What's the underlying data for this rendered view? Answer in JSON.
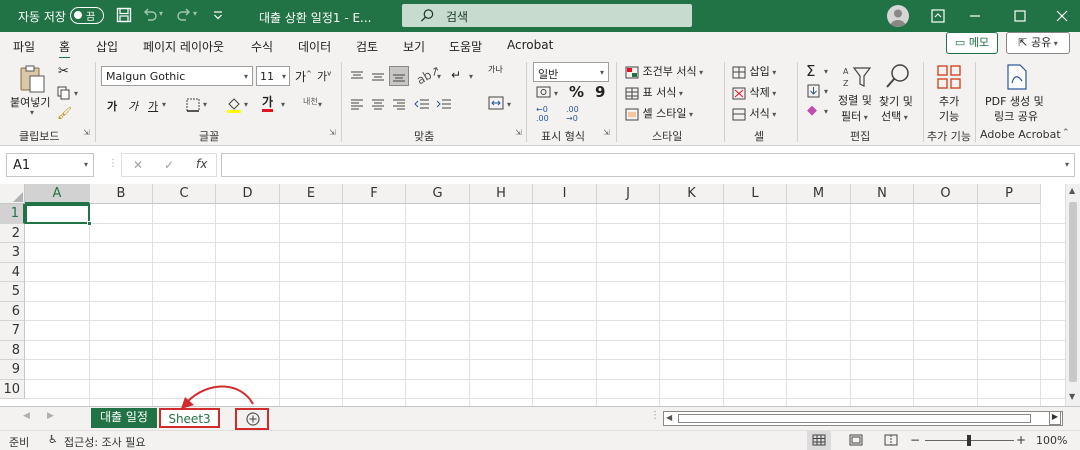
{
  "titlebar": {
    "autosave_label": "자동 저장",
    "autosave_state": "끔",
    "doc_title": "대출 상환 일정1 - E...",
    "search_label": "검색"
  },
  "menu": {
    "tabs": [
      "파일",
      "홈",
      "삽입",
      "페이지 레이아웃",
      "수식",
      "데이터",
      "검토",
      "보기",
      "도움말",
      "Acrobat"
    ],
    "active_tab": "홈",
    "memo_label": "메모",
    "share_label": "공유"
  },
  "ribbon": {
    "clipboard": {
      "paste_label": "붙여넣기",
      "group_label": "클립보드"
    },
    "font": {
      "font_name": "Malgun Gothic",
      "font_size": "11",
      "bold": "가",
      "italic": "가",
      "underline": "가",
      "font_color_sample": "가",
      "phonetic": "내천",
      "grow": "가",
      "shrink": "가",
      "group_label": "글꼴"
    },
    "alignment": {
      "wrap_label": "가나",
      "group_label": "맞춤"
    },
    "number": {
      "format": "일반",
      "percent": "%",
      "comma": "9",
      "group_label": "표시 형식"
    },
    "styles": {
      "conditional": "조건부 서식",
      "table": "표 서식",
      "cell": "셀 스타일",
      "group_label": "스타일"
    },
    "cells": {
      "insert": "삽입",
      "delete": "삭제",
      "format": "서식",
      "group_label": "셀"
    },
    "editing": {
      "sort_line1": "정렬 및",
      "sort_line2": "필터",
      "find_line1": "찾기 및",
      "find_line2": "선택",
      "group_label": "편집"
    },
    "addins": {
      "line1": "추가",
      "line2": "기능",
      "group_label": "추가 기능"
    },
    "acrobat": {
      "line1": "PDF 생성 및",
      "line2": "링크 공유",
      "group_label": "Adobe Acrobat"
    }
  },
  "formula": {
    "name_box": "A1",
    "fx": "fx",
    "cancel": "✕",
    "confirm": "✓"
  },
  "grid": {
    "columns": [
      "A",
      "B",
      "C",
      "D",
      "E",
      "F",
      "G",
      "H",
      "I",
      "J",
      "K",
      "L",
      "M",
      "N",
      "O",
      "P"
    ],
    "rows": [
      "1",
      "2",
      "3",
      "4",
      "5",
      "6",
      "7",
      "8",
      "9",
      "10"
    ],
    "selected_cell": "A1"
  },
  "sheets": {
    "tabs": [
      "대출 일정",
      "Sheet3"
    ],
    "add_symbol": "+"
  },
  "status": {
    "ready": "준비",
    "accessibility": "접근성: 조사 필요",
    "zoom": "100%",
    "zoom_minus": "−",
    "zoom_plus": "+"
  },
  "colors": {
    "excel_green": "#217346",
    "highlight_red": "#d12b2b",
    "font_color_red": "#e81123",
    "highlight_yellow": "#ffff00"
  }
}
